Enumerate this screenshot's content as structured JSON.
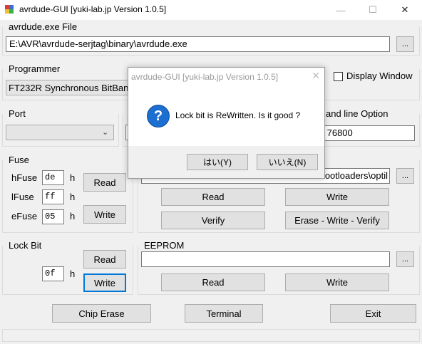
{
  "window": {
    "title": "avrdude-GUI [yuki-lab.jp Version 1.0.5]",
    "minimize": "—",
    "maximize": "☐",
    "close": "✕"
  },
  "avrdude_exe": {
    "label": "avrdude.exe File",
    "path": "E:\\AVR\\avrdude-serjtag\\binary\\avrdude.exe",
    "browse": "..."
  },
  "programmer": {
    "label": "Programmer",
    "selected": "FT232R Synchronous BitBan"
  },
  "display_window": {
    "label": "Display Window",
    "checked": false
  },
  "port": {
    "label": "Port",
    "selected": ""
  },
  "command_line": {
    "label": "and line Option",
    "value": "-B 76800"
  },
  "fuse": {
    "label": "Fuse",
    "hfuse_label": "hFuse",
    "hfuse": "de",
    "lfuse_label": "lFuse",
    "lfuse": "ff",
    "efuse_label": "eFuse",
    "efuse": "05",
    "suffix": "h",
    "read": "Read",
    "write": "Write"
  },
  "flash": {
    "path": "ootloaders\\optil",
    "browse": "...",
    "read": "Read",
    "write": "Write",
    "verify": "Verify",
    "erase_write_verify": "Erase - Write - Verify"
  },
  "lock_bit": {
    "label": "Lock Bit",
    "value": "0f",
    "suffix": "h",
    "read": "Read",
    "write": "Write"
  },
  "eeprom": {
    "label": "EEPROM",
    "path": "",
    "browse": "...",
    "read": "Read",
    "write": "Write"
  },
  "bottom": {
    "chip_erase": "Chip Erase",
    "terminal": "Terminal",
    "exit": "Exit"
  },
  "dialog": {
    "title": "avrdude-GUI [yuki-lab.jp Version 1.0.5]",
    "close": "✕",
    "icon": "question-icon",
    "icon_glyph": "?",
    "message": "Lock bit is ReWritten. Is it good ?",
    "yes": "はい(Y)",
    "no": "いいえ(N)"
  },
  "colors": {
    "accent": "#0078d7",
    "question_icon": "#1c6fd0",
    "window_bg": "#f0f0f0"
  }
}
